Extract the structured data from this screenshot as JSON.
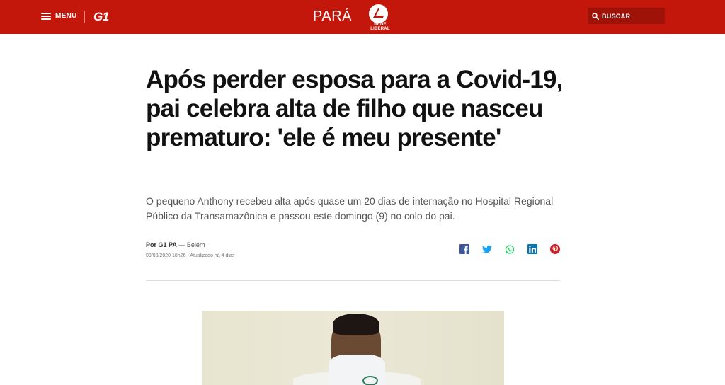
{
  "header": {
    "menu_label": "MENU",
    "site_logo": "G1",
    "region": "PARÁ",
    "affiliate_logo": "REDE LIBERAL",
    "search_label": "BUSCAR",
    "bg_color": "#c4170c"
  },
  "article": {
    "title": "Após perder esposa para a Covid-19, pai celebra alta de filho que nasceu prematuro: 'ele é meu presente'",
    "subtitle": "O pequeno Anthony recebeu alta após quase um 20 dias de internação no Hospital Regional Público da Transamazônica e passou este domingo (9) no colo do pai.",
    "byline_prefix": "Por G1 PA",
    "byline_location": " — Belém",
    "dates": "09/08/2020 18h26 · Atualizado há 4 dias"
  },
  "share": {
    "icons": [
      "facebook-icon",
      "twitter-icon",
      "whatsapp-icon",
      "linkedin-icon",
      "pinterest-icon"
    ]
  }
}
